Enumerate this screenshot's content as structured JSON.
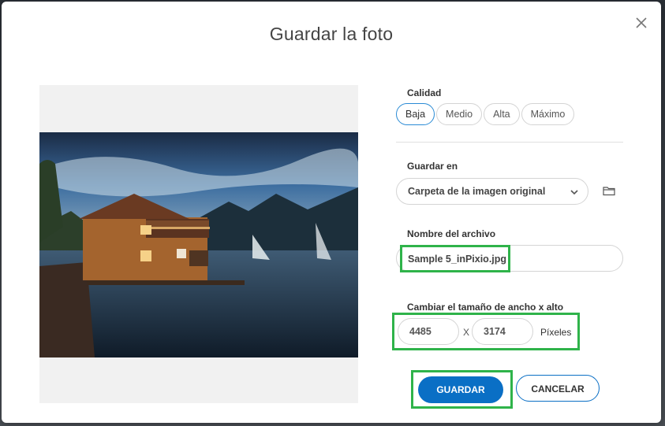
{
  "dialog": {
    "title": "Guardar la foto",
    "close_icon": "close-icon"
  },
  "quality": {
    "label": "Calidad",
    "options": [
      "Baja",
      "Medio",
      "Alta",
      "Máximo"
    ],
    "selected": "Baja"
  },
  "save_in": {
    "label": "Guardar en",
    "value": "Carpeta de la imagen original",
    "folder_icon": "folder-icon"
  },
  "file_name": {
    "label": "Nombre del archivo",
    "value": "Sample 5_inPixio.jpg"
  },
  "resize": {
    "label": "Cambiar el tamaño de ancho x alto",
    "width": "4485",
    "separator": "X",
    "height": "3174",
    "unit": "Píxeles"
  },
  "actions": {
    "save_label": "GUARDAR",
    "cancel_label": "CANCELAR"
  },
  "colors": {
    "primary": "#0a6fc5",
    "highlight": "#2fb34a",
    "selected_border": "#2a8bd5"
  }
}
